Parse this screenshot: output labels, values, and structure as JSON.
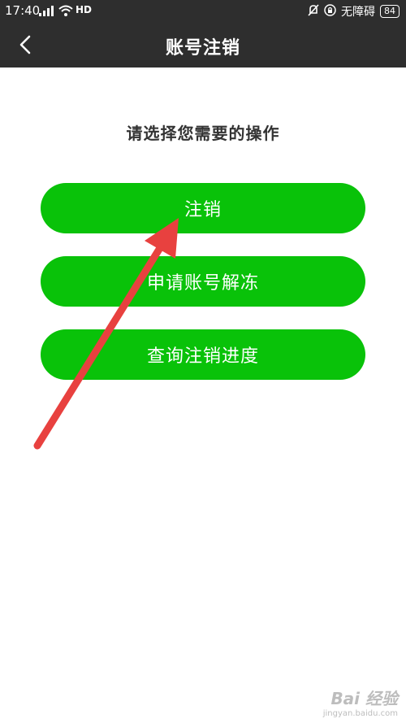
{
  "status_bar": {
    "time": "17:40",
    "hd_label": "HD",
    "accessibility_text": "无障碍",
    "battery": "84"
  },
  "header": {
    "title": "账号注销"
  },
  "main": {
    "prompt": "请选择您需要的操作",
    "buttons": [
      {
        "label": "注销"
      },
      {
        "label": "申请账号解冻"
      },
      {
        "label": "查询注销进度"
      }
    ]
  },
  "watermark": {
    "logo_text": "Bai 经验",
    "url": "jingyan.baidu.com"
  },
  "colors": {
    "header_bg": "#2e2e2e",
    "button_green": "#09c209",
    "annotation_arrow": "#e8413f"
  }
}
